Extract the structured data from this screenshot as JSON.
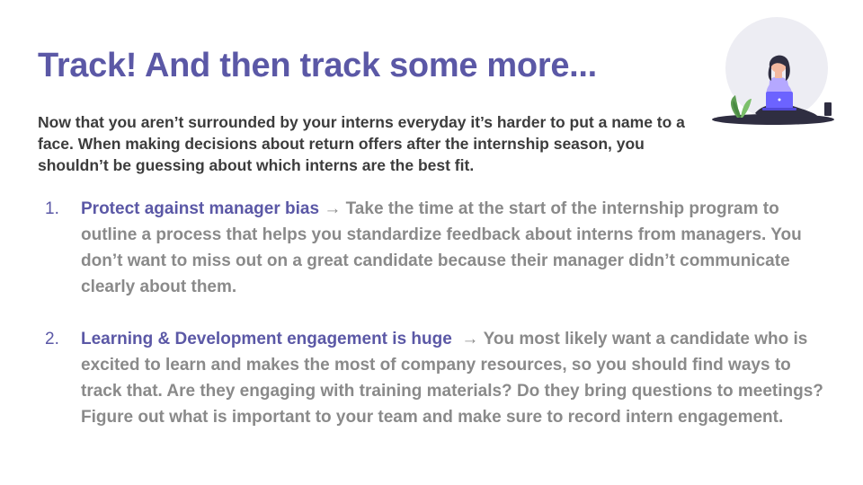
{
  "slide": {
    "title": "Track! And then track some more...",
    "intro": "Now that you aren’t surrounded by your interns everyday it’s harder to put a name to a face. When making decisions about return offers after the internship season, you shouldn’t be guessing about which interns are the best fit.",
    "items": [
      {
        "number": "1.",
        "heading": "Protect against manager bias",
        "arrow": " → ",
        "text": "Take the time at the start of the internship program to outline a process that helps you standardize feedback about interns from managers. You don’t want to miss out on a great candidate because their manager didn’t communicate clearly about them."
      },
      {
        "number": "2.",
        "heading": "Learning & Development engagement is huge",
        "arrow": "  → ",
        "text": "You most likely want a candidate who is excited to learn and makes the most of company resources, so you should find ways to track that. Are they engaging with training materials? Do they bring questions to meetings? Figure out what is important to your team and make sure to record intern engagement."
      }
    ]
  },
  "colors": {
    "accent": "#5b58a6",
    "intro_text": "#3c3c3c",
    "body_text": "#8a8a8a",
    "illustration_circle": "#ededf3",
    "laptop": "#6c63ff"
  },
  "icons": {
    "illustration": "person-with-laptop-illustration"
  }
}
